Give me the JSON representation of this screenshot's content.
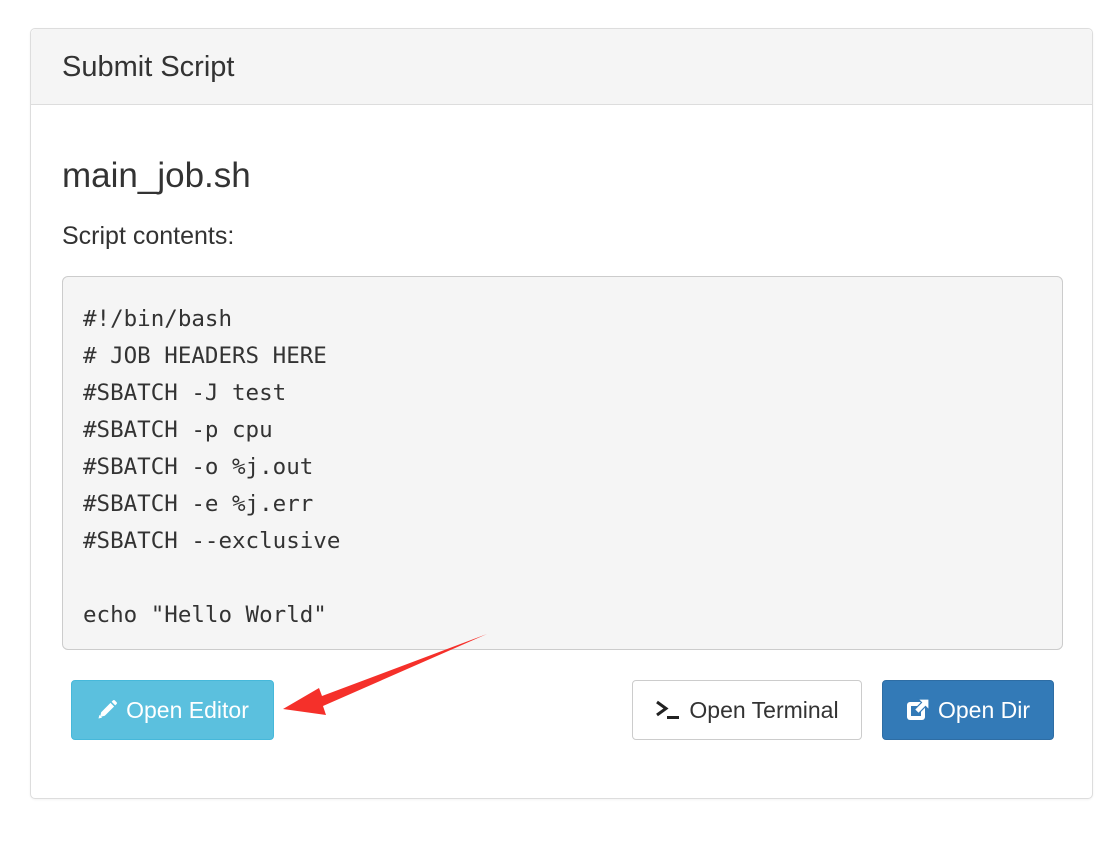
{
  "panel": {
    "title": "Submit Script"
  },
  "job": {
    "name": "main_job.sh",
    "contents_label": "Script contents:",
    "script_lines": [
      "#!/bin/bash",
      "# JOB HEADERS HERE",
      "#SBATCH -J test",
      "#SBATCH -p cpu",
      "#SBATCH -o %j.out",
      "#SBATCH -e %j.err",
      "#SBATCH --exclusive",
      "",
      "echo \"Hello World\""
    ]
  },
  "buttons": {
    "open_editor": {
      "label": "Open Editor",
      "icon": "pencil-icon",
      "color": "#5bc0de"
    },
    "open_terminal": {
      "label": "Open Terminal",
      "icon": "terminal-icon",
      "color": "#ffffff"
    },
    "open_dir": {
      "label": "Open Dir",
      "icon": "external-link-icon",
      "color": "#337ab7"
    }
  },
  "annotation": {
    "arrow_color": "#f5302a"
  }
}
